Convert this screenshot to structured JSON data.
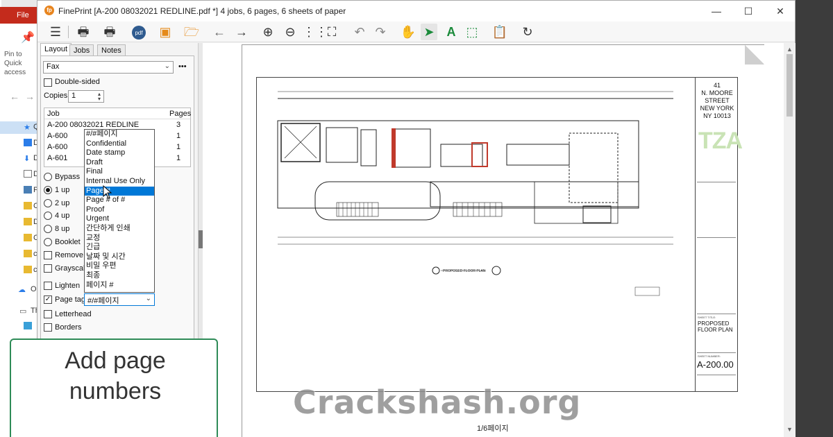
{
  "explorer": {
    "file_tab": "File",
    "pin_text": "Pin to Quick access",
    "nav_items": [
      "Qu",
      "D",
      "D",
      "D",
      "P",
      "C",
      "D",
      "C",
      "c",
      "c",
      "On",
      "Th"
    ]
  },
  "window": {
    "title": "FinePrint [A-200 08032021 REDLINE.pdf *] 4 jobs, 6 pages, 6 sheets of paper",
    "controls": [
      "minimize",
      "maximize",
      "close"
    ]
  },
  "toolbar": {
    "icons": [
      "menu-icon",
      "print-icon",
      "printer-settings-icon",
      "pdf-icon",
      "save-icon",
      "open-folder-icon",
      "back-arrow-icon",
      "forward-arrow-icon",
      "zoom-in-icon",
      "zoom-out-icon",
      "grid-icon",
      "fit-page-icon",
      "undo-icon",
      "redo-icon",
      "hand-icon",
      "pointer-icon",
      "text-tool-icon",
      "select-area-icon",
      "document-edit-icon",
      "refresh-icon"
    ]
  },
  "panel": {
    "tabs": [
      "Layout",
      "Jobs",
      "Notes"
    ],
    "printer": "Fax",
    "more": "•••",
    "double_sided": "Double-sided",
    "copies_label": "Copies:",
    "copies_value": "1",
    "job_header": "Job",
    "pages_header": "Pages",
    "jobs": [
      {
        "name": "A-200 08032021 REDLINE",
        "pages": "3"
      },
      {
        "name": "A-600",
        "pages": "1"
      },
      {
        "name": "A-600",
        "pages": "1"
      },
      {
        "name": "A-601",
        "pages": "1"
      }
    ],
    "layouts": [
      {
        "label": "Bypass",
        "selected": false
      },
      {
        "label": "1 up",
        "selected": true
      },
      {
        "label": "2 up",
        "selected": false
      },
      {
        "label": "4 up",
        "selected": false
      },
      {
        "label": "8 up",
        "selected": false
      },
      {
        "label": "Booklet",
        "selected": false
      }
    ],
    "remove_blank": "Remove b",
    "grayscale": "Grayscale",
    "lighten": "Lighten",
    "page_tag": "Page tag",
    "page_tag_value": "#/#페이지",
    "letterhead": "Letterhead",
    "borders": "Borders"
  },
  "dropdown": {
    "options": [
      "#/#페이지",
      "Confidential",
      "Date stamp",
      "Draft",
      "Final",
      "Internal Use Only",
      "Page #",
      "Page # of #",
      "Proof",
      "Urgent",
      "간단하게 인쇄",
      "교정",
      "긴급",
      "날짜 및 시간",
      "비밀 우편",
      "최종",
      "페이지 #"
    ],
    "highlighted": "Page #"
  },
  "drawing": {
    "address": [
      "41",
      "N. MOORE",
      "STREET",
      "NEW YORK",
      "NY 10013"
    ],
    "logo": "TZA",
    "sheet_title_label": "SHEET TITLE:",
    "sheet_title": [
      "PROPOSED",
      "FLOOR PLAN"
    ],
    "sheet_number_label": "SHEET NUMBER:",
    "sheet_number": "A-200.00",
    "plan_caption": "PROPOSED FLOOR PLAN"
  },
  "page_label": "1/6페이지",
  "callout": [
    "Add page",
    "numbers"
  ],
  "watermark": "Crackshash.org"
}
